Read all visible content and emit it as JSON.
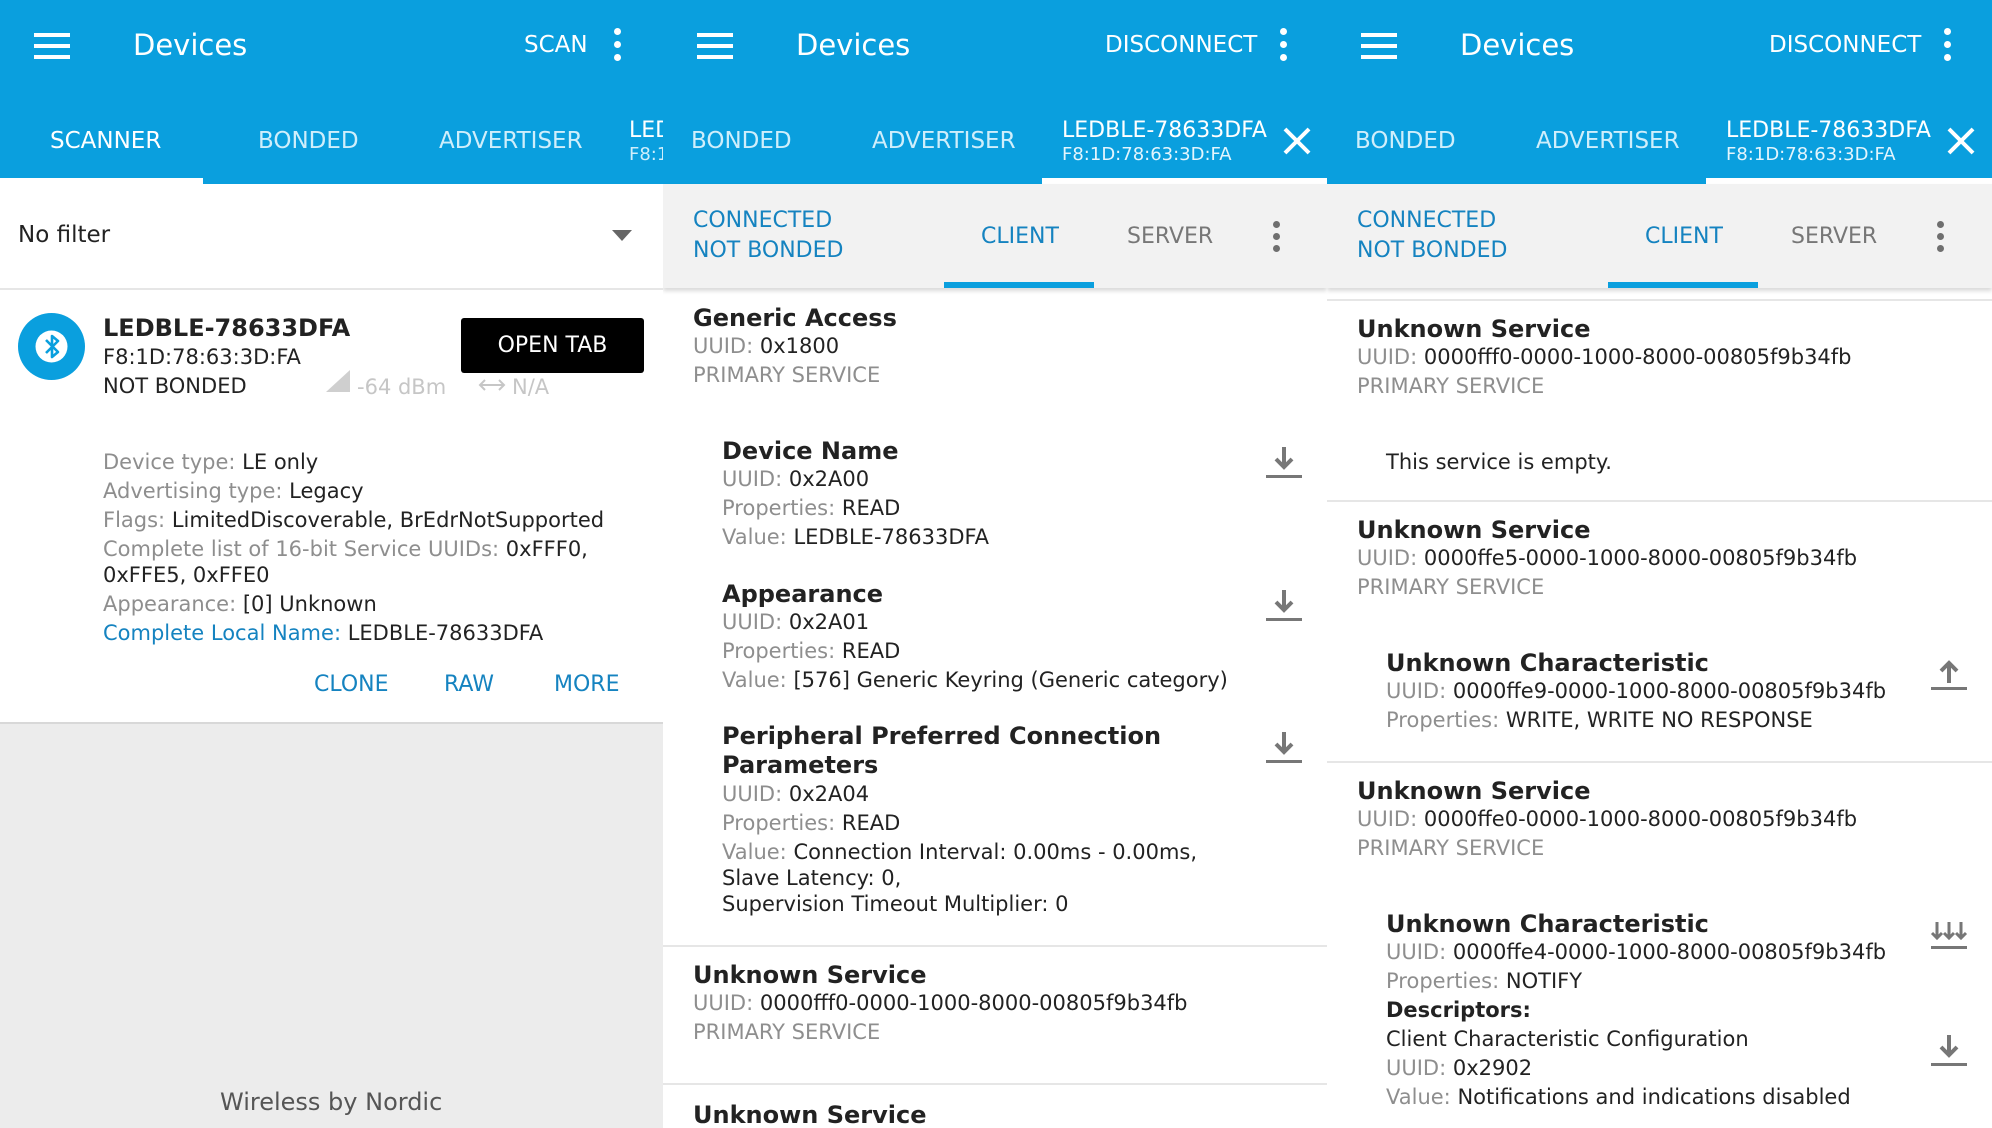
{
  "panel1": {
    "title": "Devices",
    "action": "SCAN",
    "tabs": [
      "SCANNER",
      "BONDED",
      "ADVERTISER",
      "LED",
      "F8:1"
    ],
    "filter": "No filter",
    "device": {
      "name": "LEDBLE-78633DFA",
      "mac": "F8:1D:78:63:3D:FA",
      "bond": "NOT BONDED",
      "open_tab": "OPEN TAB",
      "rssi": "-64 dBm",
      "interval": "N/A",
      "device_type_label": "Device type:",
      "device_type": "LE only",
      "adv_type_label": "Advertising type:",
      "adv_type": "Legacy",
      "flags_label": "Flags:",
      "flags": "LimitedDiscoverable, BrEdrNotSupported",
      "uuids_label": "Complete list of 16-bit Service UUIDs:",
      "uuids_1": "0xFFF0,",
      "uuids_2": "0xFFE5, 0xFFE0",
      "appearance_label": "Appearance:",
      "appearance": "[0] Unknown",
      "local_name_label": "Complete Local Name:",
      "local_name": "LEDBLE-78633DFA"
    },
    "buttons": [
      "CLONE",
      "RAW",
      "MORE"
    ],
    "footer": "Wireless by Nordic"
  },
  "panel2": {
    "title": "Devices",
    "action": "DISCONNECT",
    "tabs": [
      "BONDED",
      "ADVERTISER"
    ],
    "device_tab_name": "LEDBLE-78633DFA",
    "device_tab_mac": "F8:1D:78:63:3D:FA",
    "status1": "CONNECTED",
    "status2": "NOT BONDED",
    "client": "CLIENT",
    "server": "SERVER",
    "service1": {
      "name": "Generic Access",
      "uuid_label": "UUID:",
      "uuid": "0x1800",
      "type": "PRIMARY SERVICE",
      "chars": [
        {
          "name": "Device Name",
          "uuid": "0x2A00",
          "props": "READ",
          "value": "LEDBLE-78633DFA"
        },
        {
          "name": "Appearance",
          "uuid": "0x2A01",
          "props": "READ",
          "value": "[576] Generic Keyring (Generic category)"
        },
        {
          "name1": "Peripheral Preferred Connection",
          "name2": "Parameters",
          "uuid": "0x2A04",
          "props": "READ",
          "value1": "Connection Interval: 0.00ms - 0.00ms,",
          "value2": "Slave Latency: 0,",
          "value3": "Supervision Timeout Multiplier: 0"
        }
      ]
    },
    "service2": {
      "name": "Unknown Service",
      "uuid": "0000fff0-0000-1000-8000-00805f9b34fb",
      "type": "PRIMARY SERVICE"
    },
    "service3": {
      "name": "Unknown Service"
    },
    "labels": {
      "uuid": "UUID:",
      "props": "Properties:",
      "value": "Value:"
    }
  },
  "panel3": {
    "title": "Devices",
    "action": "DISCONNECT",
    "tabs": [
      "BONDED",
      "ADVERTISER"
    ],
    "device_tab_name": "LEDBLE-78633DFA",
    "device_tab_mac": "F8:1D:78:63:3D:FA",
    "status1": "CONNECTED",
    "status2": "NOT BONDED",
    "client": "CLIENT",
    "server": "SERVER",
    "service1": {
      "name": "Unknown Service",
      "uuid": "0000fff0-0000-1000-8000-00805f9b34fb",
      "type": "PRIMARY SERVICE",
      "empty": "This service is empty."
    },
    "service2": {
      "name": "Unknown Service",
      "uuid": "0000ffe5-0000-1000-8000-00805f9b34fb",
      "type": "PRIMARY SERVICE",
      "char": {
        "name": "Unknown Characteristic",
        "uuid": "0000ffe9-0000-1000-8000-00805f9b34fb",
        "props": "WRITE, WRITE NO RESPONSE"
      }
    },
    "service3": {
      "name": "Unknown Service",
      "uuid": "0000ffe0-0000-1000-8000-00805f9b34fb",
      "type": "PRIMARY SERVICE",
      "char": {
        "name": "Unknown Characteristic",
        "uuid": "0000ffe4-0000-1000-8000-00805f9b34fb",
        "props": "NOTIFY",
        "descriptors_label": "Descriptors:",
        "descriptor_name": "Client Characteristic Configuration",
        "descriptor_uuid": "0x2902",
        "descriptor_value": "Notifications and indications disabled"
      }
    },
    "labels": {
      "uuid": "UUID:",
      "props": "Properties:",
      "value": "Value:"
    }
  },
  "icons": [
    "menu-icon",
    "overflow-icon",
    "dropdown-icon",
    "bluetooth-icon",
    "signal-icon",
    "interval-icon",
    "close-icon",
    "download-icon",
    "upload-icon",
    "notify-icon"
  ],
  "colors": {
    "app_bar": "#0a9fde",
    "accent": "#1583c0",
    "page_bg": "#ececec"
  }
}
